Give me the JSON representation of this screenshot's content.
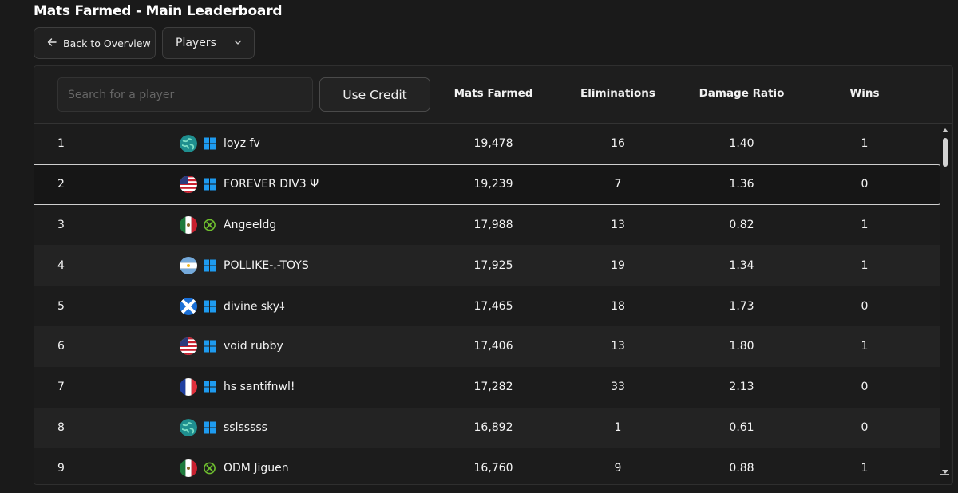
{
  "header": {
    "title": "Mats Farmed - Main Leaderboard",
    "back_label": "Back to Overview",
    "view_select_value": "Players"
  },
  "toolbar": {
    "search_placeholder": "Search for a player",
    "search_value": "",
    "credit_label": "Use Credit"
  },
  "columns": {
    "mats": "Mats Farmed",
    "elims": "Eliminations",
    "damage": "Damage Ratio",
    "wins": "Wins"
  },
  "rows": [
    {
      "rank": "1",
      "flag": "globe-flag-icon",
      "platform": "windows-icon",
      "name": "loyz fv",
      "mats": "19,478",
      "elims": "16",
      "damage": "1.40",
      "wins": "1"
    },
    {
      "rank": "2",
      "flag": "us-flag-icon",
      "platform": "windows-icon",
      "name": "FOREVER DIV3 Ψ",
      "mats": "19,239",
      "elims": "7",
      "damage": "1.36",
      "wins": "0"
    },
    {
      "rank": "3",
      "flag": "mx-flag-icon",
      "platform": "xbox-icon",
      "name": "Angeeldg",
      "mats": "17,988",
      "elims": "13",
      "damage": "0.82",
      "wins": "1"
    },
    {
      "rank": "4",
      "flag": "ar-flag-icon",
      "platform": "windows-icon",
      "name": "POLLIKE-.-TOYS",
      "mats": "17,925",
      "elims": "19",
      "damage": "1.34",
      "wins": "1"
    },
    {
      "rank": "5",
      "flag": "scotland-flag-icon",
      "platform": "windows-icon",
      "name": "divine sky⸸",
      "mats": "17,465",
      "elims": "18",
      "damage": "1.73",
      "wins": "0"
    },
    {
      "rank": "6",
      "flag": "us-flag-icon",
      "platform": "windows-icon",
      "name": "void rubby",
      "mats": "17,406",
      "elims": "13",
      "damage": "1.80",
      "wins": "1"
    },
    {
      "rank": "7",
      "flag": "fr-flag-icon",
      "platform": "windows-icon",
      "name": "hs santifnwl!",
      "mats": "17,282",
      "elims": "33",
      "damage": "2.13",
      "wins": "0"
    },
    {
      "rank": "8",
      "flag": "globe-flag-icon",
      "platform": "windows-icon",
      "name": "sslsssss",
      "mats": "16,892",
      "elims": "1",
      "damage": "0.61",
      "wins": "0"
    },
    {
      "rank": "9",
      "flag": "mx-flag-icon",
      "platform": "xbox-icon",
      "name": "ODM Jiguen",
      "mats": "16,760",
      "elims": "9",
      "damage": "0.88",
      "wins": "1"
    }
  ],
  "colors": {
    "background": "#1a1a1a",
    "windows_blue": "#1e9bf0",
    "xbox_green": "#6fbf2f"
  }
}
